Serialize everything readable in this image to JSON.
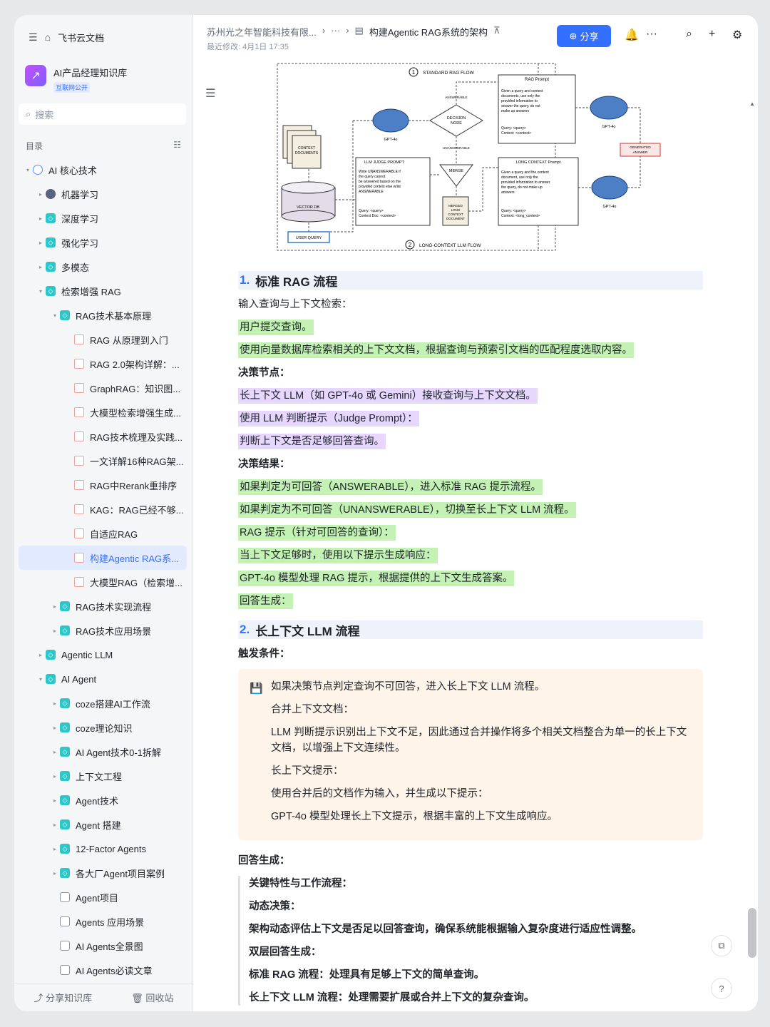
{
  "app": {
    "name": "飞书云文档"
  },
  "kb": {
    "name": "AI产品经理知识库",
    "badge": "互联网公开"
  },
  "search": {
    "placeholder": "搜索"
  },
  "toc": {
    "label": "目录"
  },
  "tree": [
    {
      "label": "AI 核心技术",
      "level": 0,
      "caret": "▾",
      "icon": "globe"
    },
    {
      "label": "机器学习",
      "level": 1,
      "caret": "▸",
      "icon": "robot"
    },
    {
      "label": "深度学习",
      "level": 1,
      "caret": "▸",
      "icon": "teal"
    },
    {
      "label": "强化学习",
      "level": 1,
      "caret": "▸",
      "icon": "teal"
    },
    {
      "label": "多模态",
      "level": 1,
      "caret": "▸",
      "icon": "teal"
    },
    {
      "label": "检索增强 RAG",
      "level": 1,
      "caret": "▾",
      "icon": "teal"
    },
    {
      "label": "RAG技术基本原理",
      "level": 2,
      "caret": "▾",
      "icon": "teal"
    },
    {
      "label": "RAG 从原理到入门",
      "level": 3,
      "caret": "",
      "icon": "docred"
    },
    {
      "label": "RAG 2.0架构详解：...",
      "level": 3,
      "caret": "",
      "icon": "docred"
    },
    {
      "label": "GraphRAG：知识图...",
      "level": 3,
      "caret": "",
      "icon": "docred"
    },
    {
      "label": "大模型检索增强生成...",
      "level": 3,
      "caret": "",
      "icon": "docred"
    },
    {
      "label": "RAG技术梳理及实践...",
      "level": 3,
      "caret": "",
      "icon": "docred"
    },
    {
      "label": "一文详解16种RAG架...",
      "level": 3,
      "caret": "",
      "icon": "docred"
    },
    {
      "label": "RAG中Rerank重排序",
      "level": 3,
      "caret": "",
      "icon": "docred"
    },
    {
      "label": "KAG：RAG已经不够...",
      "level": 3,
      "caret": "",
      "icon": "docred"
    },
    {
      "label": "自适应RAG",
      "level": 3,
      "caret": "",
      "icon": "docred"
    },
    {
      "label": "构建Agentic RAG系...",
      "level": 3,
      "caret": "",
      "icon": "docred",
      "active": true
    },
    {
      "label": "大模型RAG（检索增...",
      "level": 3,
      "caret": "",
      "icon": "docred"
    },
    {
      "label": "RAG技术实现流程",
      "level": 2,
      "caret": "▸",
      "icon": "teal"
    },
    {
      "label": "RAG技术应用场景",
      "level": 2,
      "caret": "▸",
      "icon": "teal"
    },
    {
      "label": "Agentic LLM",
      "level": 1,
      "caret": "▸",
      "icon": "teal"
    },
    {
      "label": "AI Agent",
      "level": 1,
      "caret": "▾",
      "icon": "teal"
    },
    {
      "label": "coze搭建AI工作流",
      "level": 2,
      "caret": "▸",
      "icon": "teal"
    },
    {
      "label": "coze理论知识",
      "level": 2,
      "caret": "▸",
      "icon": "teal"
    },
    {
      "label": "AI Agent技术0-1拆解",
      "level": 2,
      "caret": "▸",
      "icon": "teal"
    },
    {
      "label": "上下文工程",
      "level": 2,
      "caret": "▸",
      "icon": "teal"
    },
    {
      "label": "Agent技术",
      "level": 2,
      "caret": "▸",
      "icon": "teal"
    },
    {
      "label": "Agent 搭建",
      "level": 2,
      "caret": "▸",
      "icon": "teal"
    },
    {
      "label": "12-Factor Agents",
      "level": 2,
      "caret": "▸",
      "icon": "teal"
    },
    {
      "label": "各大厂Agent项目案例",
      "level": 2,
      "caret": "▸",
      "icon": "teal"
    },
    {
      "label": "Agent项目",
      "level": 2,
      "caret": "",
      "icon": "sq"
    },
    {
      "label": "Agents 应用场景",
      "level": 2,
      "caret": "",
      "icon": "sq"
    },
    {
      "label": "AI Agents全景图",
      "level": 2,
      "caret": "",
      "icon": "sq"
    },
    {
      "label": "AI Agents必读文章",
      "level": 2,
      "caret": "",
      "icon": "sq"
    }
  ],
  "footer": {
    "share": "分享知识库",
    "trash": "回收站"
  },
  "header": {
    "crumb1": "苏州光之年智能科技有限...",
    "crumb_more": "···",
    "current": "构建Agentic RAG系统的架构",
    "modified": "最近修改: 4月1日 17:35",
    "share_label": "分享"
  },
  "diagram": {
    "standard_flow": "STANDARD RAG FLOW",
    "long_flow": "LONG-CONTEXT LLM FLOW",
    "num1": "1",
    "num2": "2",
    "rag_prompt_title": "RAG Prompt",
    "rag_prompt_body": [
      "Given a query and context",
      "documents, use only the",
      "provided information to",
      "answer the query, do not",
      "make up answers"
    ],
    "rag_prompt_q": [
      "Query: <query>",
      "Context: <context>"
    ],
    "judge_title": "LLM JUDGE PROMPT",
    "judge_body": [
      "Write UNANSWERABLE if",
      "the query cannot",
      "be answered based on the",
      "provided context else write",
      "ANSWERABLE"
    ],
    "judge_q": [
      "Query: <query>",
      "Context Doc: <context>"
    ],
    "long_title": "LONG CONTEXT Prompt",
    "long_body": [
      "Given a query and the context",
      "document, use only the",
      "provided information to answer",
      "the query, do not make up",
      "answers"
    ],
    "long_q": [
      "Query: <query>",
      "Context: <long_context>"
    ],
    "decision": [
      "DECISION",
      "NODE"
    ],
    "answerable": "ANSWERABLE",
    "unanswerable": "UNANSWERABLE",
    "merge": "MERGE",
    "gpt": "GPT-4o",
    "generated": [
      "GENERATED",
      "ANSWER"
    ],
    "context_docs": [
      "CONTEXT",
      "DOCUMENTS"
    ],
    "vector_db": "VECTOR DB",
    "user_query": "USER QUERY",
    "merged": [
      "MERGED",
      "LONG",
      "CONTEXT",
      "DOCUMENT"
    ]
  },
  "doc": {
    "h1_num": "1.",
    "h1": "标准 RAG 流程",
    "p1": "输入查询与上下文检索：",
    "g1": "用户提交查询。",
    "g2": "使用向量数据库检索相关的上下文文档，根据查询与预索引文档的匹配程度选取内容。",
    "b1": "决策节点：",
    "v1": "长上下文 LLM（如 GPT-4o 或 Gemini）接收查询与上下文文档。",
    "v2": "使用 LLM 判断提示（Judge Prompt）：",
    "v3": "判断上下文是否足够回答查询。",
    "b2": "决策结果：",
    "g3": "如果判定为可回答（ANSWERABLE），进入标准 RAG 提示流程。",
    "g4": "如果判定为不可回答（UNANSWERABLE），切换至长上下文 LLM 流程。",
    "g5": "RAG 提示（针对可回答的查询）：",
    "g6": "当上下文足够时，使用以下提示生成响应：",
    "g7": "GPT-4o 模型处理 RAG 提示，根据提供的上下文生成答案。",
    "g8": "回答生成：",
    "h2_num": "2.",
    "h2": "长上下文 LLM 流程",
    "b3": "触发条件：",
    "c1": "如果决策节点判定查询不可回答，进入长上下文 LLM 流程。",
    "c2": "合并上下文文档：",
    "c3": "LLM 判断提示识别出上下文不足，因此通过合并操作将多个相关文档整合为单一的长上下文文档，以增强上下文连续性。",
    "c4": "长上下文提示：",
    "c5": "使用合并后的文档作为输入，并生成以下提示：",
    "c6": "GPT-4o 模型处理长上下文提示，根据丰富的上下文生成响应。",
    "b4": "回答生成：",
    "q1": "关键特性与工作流程：",
    "q2": "动态决策：",
    "q3": "架构动态评估上下文是否足以回答查询，确保系统能根据输入复杂度进行适应性调整。",
    "q4": "双层回答生成：",
    "q5": "标准 RAG 流程：处理具有足够上下文的简单查询。",
    "q6": "长上下文 LLM 流程：处理需要扩展或合并上下文的复杂查询。"
  }
}
